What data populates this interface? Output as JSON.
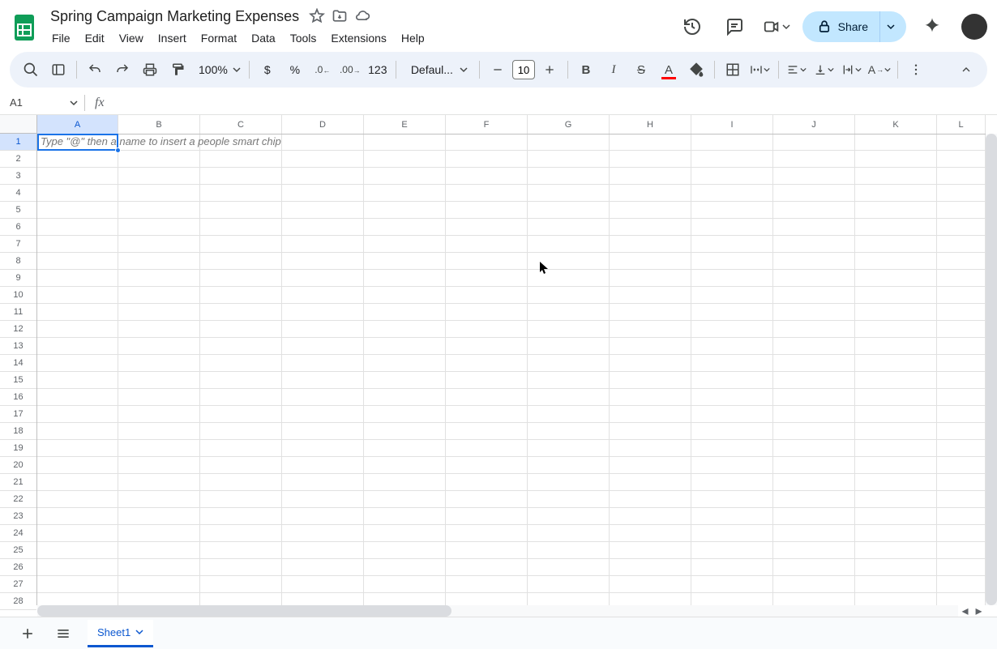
{
  "title": "Spring Campaign Marketing Expenses",
  "menu": [
    "File",
    "Edit",
    "View",
    "Insert",
    "Format",
    "Data",
    "Tools",
    "Extensions",
    "Help"
  ],
  "share_label": "Share",
  "toolbar": {
    "zoom": "100%",
    "currency": "$",
    "percent": "%",
    "dec_dec": ".0",
    "inc_dec": ".00",
    "numfmt": "123",
    "font": "Defaul...",
    "fontsize": "10",
    "bold": "B",
    "italic": "I",
    "strike": "S"
  },
  "namebox": "A1",
  "formula": "",
  "columns": [
    "A",
    "B",
    "C",
    "D",
    "E",
    "F",
    "G",
    "H",
    "I",
    "J",
    "K",
    "L"
  ],
  "rows": [
    "1",
    "2",
    "3",
    "4",
    "5",
    "6",
    "7",
    "8",
    "9",
    "10",
    "11",
    "12",
    "13",
    "14",
    "15",
    "16",
    "17",
    "18",
    "19",
    "20",
    "21",
    "22",
    "23",
    "24",
    "25",
    "26",
    "27",
    "28"
  ],
  "placeholder_text": "Type \"@\" then a name to insert a people smart chip",
  "sheet_tab": "Sheet1"
}
